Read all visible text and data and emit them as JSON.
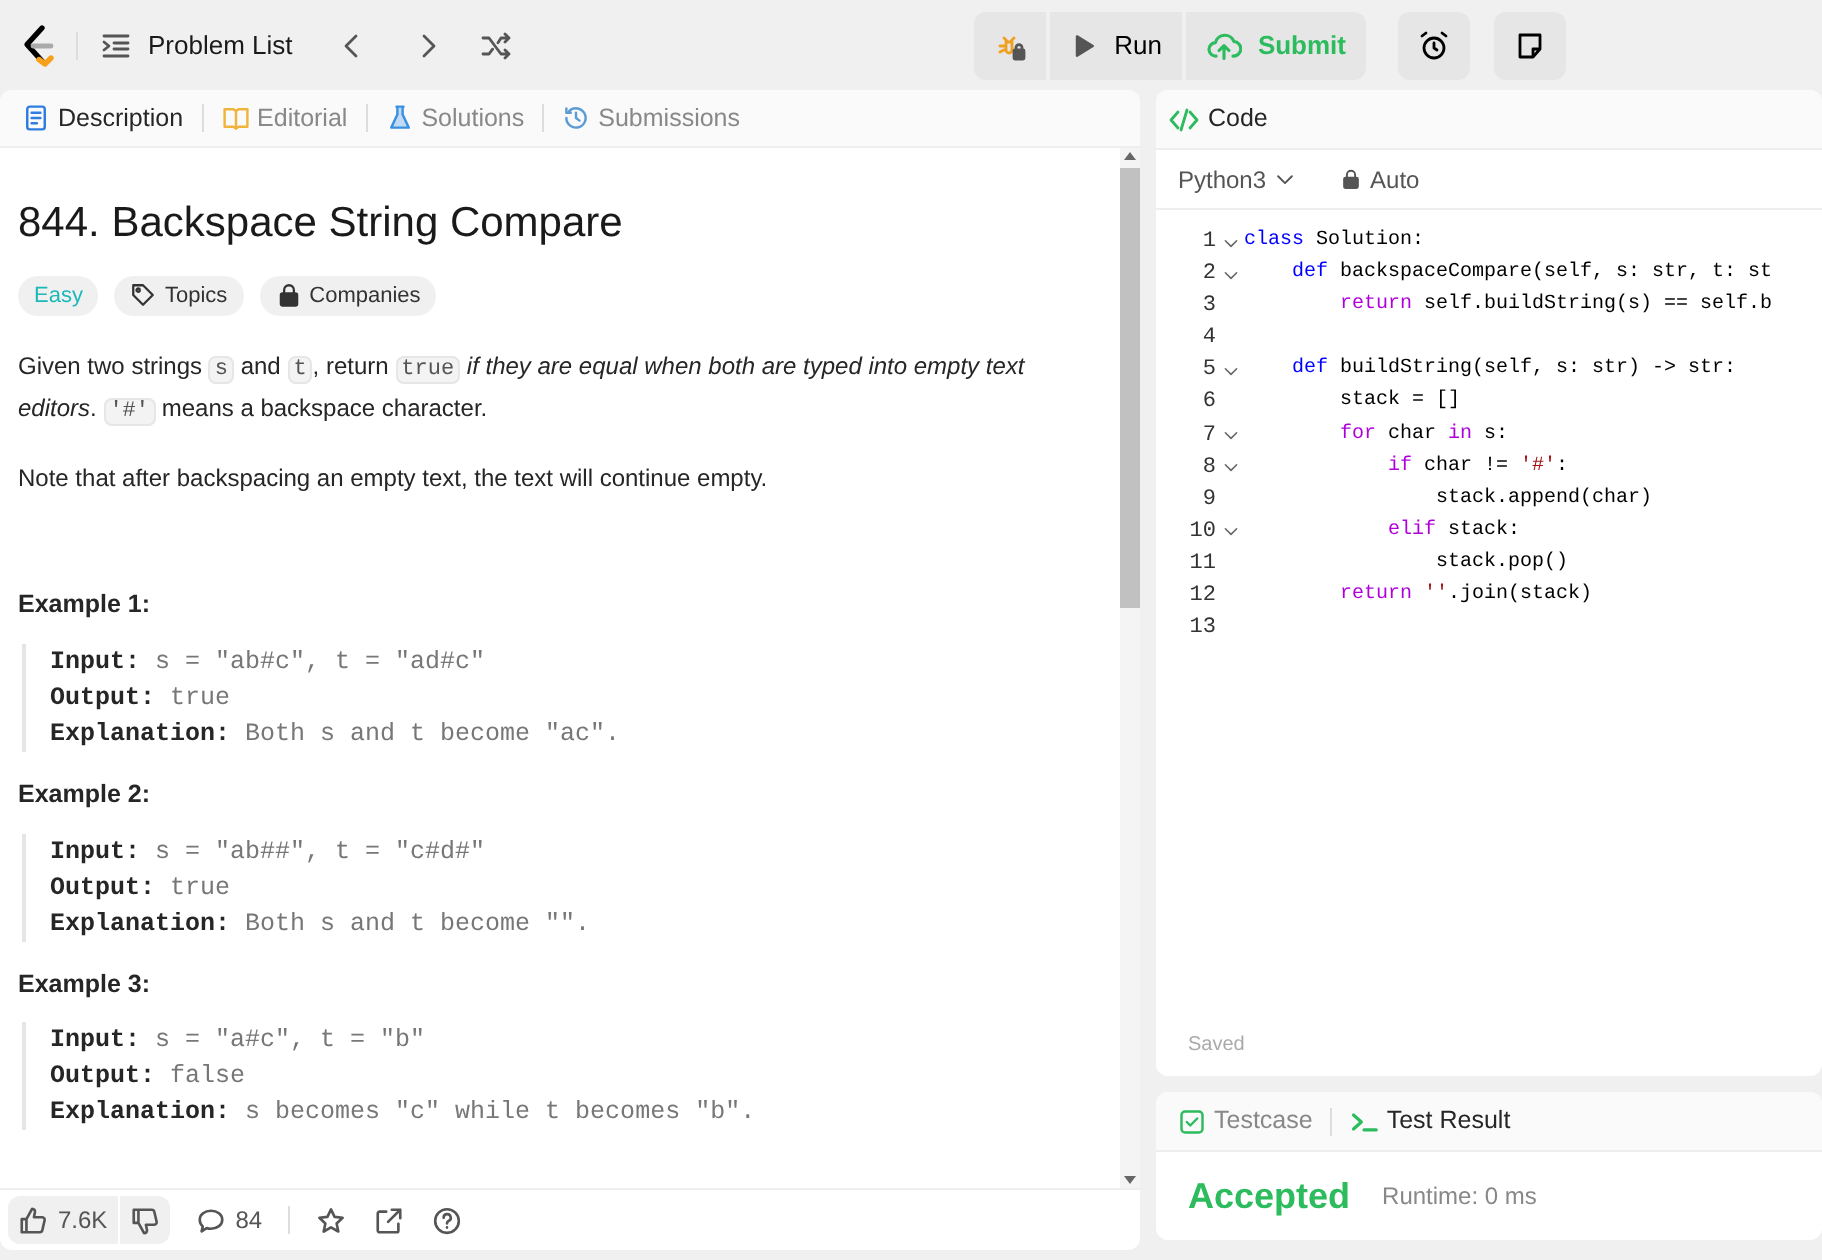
{
  "topbar": {
    "problem_list": "Problem List",
    "run": "Run",
    "submit": "Submit"
  },
  "description_tabs": [
    {
      "label": "Description",
      "selected": true
    },
    {
      "label": "Editorial",
      "selected": false
    },
    {
      "label": "Solutions",
      "selected": false
    },
    {
      "label": "Submissions",
      "selected": false
    }
  ],
  "problem": {
    "title": "844. Backspace String Compare",
    "difficulty": "Easy",
    "tags": [
      {
        "label": "Topics"
      },
      {
        "label": "Companies"
      }
    ],
    "paragraphs": [
      [
        {
          "kind": "text",
          "text": "Given two strings "
        },
        {
          "kind": "code",
          "text": "s"
        },
        {
          "kind": "text",
          "text": " and "
        },
        {
          "kind": "code",
          "text": "t"
        },
        {
          "kind": "text",
          "text": ", return "
        },
        {
          "kind": "code",
          "text": "true"
        },
        {
          "kind": "italic",
          "text": " if they are equal when both are typed into empty text editors"
        },
        {
          "kind": "text",
          "text": ". "
        },
        {
          "kind": "code",
          "text": "'#'"
        },
        {
          "kind": "text",
          "text": " means a backspace character."
        }
      ],
      [
        {
          "kind": "text",
          "text": "Note that after backspacing an empty text, the text will continue empty."
        }
      ]
    ],
    "examples": [
      {
        "title": "Example 1:",
        "lines": [
          {
            "label": "Input:",
            "value": "s = \"ab#c\", t = \"ad#c\""
          },
          {
            "label": "Output:",
            "value": "true"
          },
          {
            "label": "Explanation:",
            "value": "Both s and t become \"ac\"."
          }
        ]
      },
      {
        "title": "Example 2:",
        "lines": [
          {
            "label": "Input:",
            "value": "s = \"ab##\", t = \"c#d#\""
          },
          {
            "label": "Output:",
            "value": "true"
          },
          {
            "label": "Explanation:",
            "value": "Both s and t become \"\"."
          }
        ]
      },
      {
        "title": "Example 3:",
        "lines": [
          {
            "label": "Input:",
            "value": "s = \"a#c\", t = \"b\""
          },
          {
            "label": "Output:",
            "value": "false"
          },
          {
            "label": "Explanation:",
            "value": "s becomes \"c\" while t becomes \"b\"."
          }
        ]
      }
    ]
  },
  "footer": {
    "likes": "7.6K",
    "comments": "84"
  },
  "code_panel": {
    "title": "Code",
    "language": "Python3",
    "mode": "Auto",
    "status": "Saved",
    "lines": [
      {
        "number": "1",
        "fold": true,
        "tokens": [
          {
            "kind": "keyword",
            "text": "class"
          },
          {
            "kind": "plain",
            "text": " Solution:"
          }
        ]
      },
      {
        "number": "2",
        "fold": true,
        "tokens": [
          {
            "kind": "keyword",
            "text": "    def"
          },
          {
            "kind": "plain",
            "text": " backspaceCompare(self, s: str, t: st"
          }
        ]
      },
      {
        "number": "3",
        "fold": false,
        "tokens": [
          {
            "kind": "control",
            "text": "        return"
          },
          {
            "kind": "plain",
            "text": " self.buildString(s) == self.b"
          }
        ]
      },
      {
        "number": "4",
        "fold": false
      },
      {
        "number": "5",
        "fold": true,
        "tokens": [
          {
            "kind": "keyword",
            "text": "    def"
          },
          {
            "kind": "plain",
            "text": " buildString(self, s: str) -> str:"
          }
        ]
      },
      {
        "number": "6",
        "fold": false,
        "tokens": [
          {
            "kind": "plain",
            "text": "        stack = []"
          }
        ]
      },
      {
        "number": "7",
        "fold": true,
        "tokens": [
          {
            "kind": "control",
            "text": "        for"
          },
          {
            "kind": "plain",
            "text": " char "
          },
          {
            "kind": "control",
            "text": "in"
          },
          {
            "kind": "plain",
            "text": " s:"
          }
        ]
      },
      {
        "number": "8",
        "fold": true,
        "tokens": [
          {
            "kind": "control",
            "text": "            if"
          },
          {
            "kind": "plain",
            "text": " char != "
          },
          {
            "kind": "string",
            "text": "'#'"
          },
          {
            "kind": "plain",
            "text": ":"
          }
        ]
      },
      {
        "number": "9",
        "fold": false,
        "tokens": [
          {
            "kind": "plain",
            "text": "                stack.append(char)"
          }
        ]
      },
      {
        "number": "10",
        "fold": true,
        "tokens": [
          {
            "kind": "control",
            "text": "            elif"
          },
          {
            "kind": "plain",
            "text": " stack:"
          }
        ]
      },
      {
        "number": "11",
        "fold": false,
        "tokens": [
          {
            "kind": "plain",
            "text": "                stack.pop()"
          }
        ]
      },
      {
        "number": "12",
        "fold": false,
        "tokens": [
          {
            "kind": "control",
            "text": "        return"
          },
          {
            "kind": "string",
            "text": " ''"
          },
          {
            "kind": "plain",
            "text": ".join(stack)"
          }
        ]
      },
      {
        "number": "13",
        "fold": false
      }
    ]
  },
  "result_tabs": [
    {
      "label": "Testcase",
      "selected": false
    },
    {
      "label": "Test Result",
      "selected": true
    }
  ],
  "result": {
    "verdict": "Accepted",
    "runtime": "Runtime: 0 ms"
  }
}
